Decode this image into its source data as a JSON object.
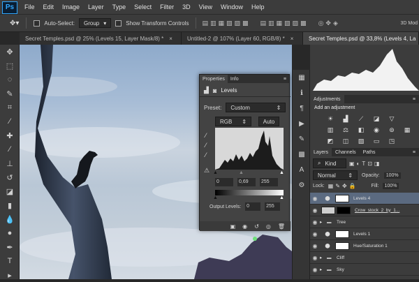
{
  "menubar": {
    "logo": "Ps",
    "items": [
      "File",
      "Edit",
      "Image",
      "Layer",
      "Type",
      "Select",
      "Filter",
      "3D",
      "View",
      "Window",
      "Help"
    ]
  },
  "options": {
    "auto_select_label": "Auto-Select:",
    "group_value": "Group",
    "transform_label": "Show Transform Controls",
    "right_label": "3D Mod"
  },
  "tabs": [
    {
      "label": "Secret Temples.psd @ 25% (Levels 15, Layer Mask/8) *",
      "active": false
    },
    {
      "label": "Untitled-2 @ 107% (Layer 60, RGB/8) *",
      "active": false
    },
    {
      "label": "Secret Temples.psd @ 33,8% (Levels 4, La",
      "active": true
    }
  ],
  "properties": {
    "tabs": [
      "Properties",
      "Info"
    ],
    "title": "Levels",
    "preset_label": "Preset:",
    "preset_value": "Custom",
    "channel_value": "RGB",
    "auto_label": "Auto",
    "input_black": "0",
    "input_gamma": "0,69",
    "input_white": "255",
    "output_label": "Output Levels:",
    "output_black": "0",
    "output_white": "255"
  },
  "adjustments": {
    "tab": "Adjustments",
    "add_label": "Add an adjustment"
  },
  "layers_panel": {
    "tabs": [
      "Layers",
      "Channels",
      "Paths"
    ],
    "kind_value": "Kind",
    "blend_value": "Normal",
    "opacity_label": "Opacity:",
    "opacity_value": "100%",
    "lock_label": "Lock:",
    "fill_label": "Fill:",
    "fill_value": "100%",
    "layers": [
      {
        "name": "Levels 4",
        "type": "adjust",
        "selected": true
      },
      {
        "name": "Crow_stock_2_by_1...",
        "type": "image",
        "selected": false
      },
      {
        "name": "Tree",
        "type": "group",
        "selected": false
      },
      {
        "name": "Levels 1",
        "type": "adjust",
        "selected": false
      },
      {
        "name": "Hue/Saturation 1",
        "type": "adjust",
        "selected": false
      },
      {
        "name": "Cliff",
        "type": "group",
        "selected": false
      },
      {
        "name": "Sky",
        "type": "group",
        "selected": false
      }
    ]
  },
  "colors": {
    "ps_blue": "#31a8ff",
    "selection": "#5b6a80",
    "panel": "#434343"
  }
}
